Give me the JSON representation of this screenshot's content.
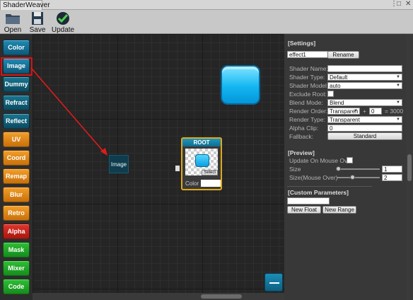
{
  "window": {
    "tab_title": "ShaderWeaver",
    "controls": [
      "⋮",
      "□",
      "✕"
    ]
  },
  "toolbar": {
    "open_label": "Open",
    "save_label": "Save",
    "update_label": "Update"
  },
  "palette": [
    {
      "label": "Color",
      "color": "blue"
    },
    {
      "label": "Image",
      "color": "blue"
    },
    {
      "label": "Dummy",
      "color": "teal"
    },
    {
      "label": "Refract",
      "color": "teal"
    },
    {
      "label": "Reflect",
      "color": "teal"
    },
    {
      "label": "UV",
      "color": "orange"
    },
    {
      "label": "Coord",
      "color": "orange"
    },
    {
      "label": "Remap",
      "color": "orange"
    },
    {
      "label": "Blur",
      "color": "orange"
    },
    {
      "label": "Retro",
      "color": "orange"
    },
    {
      "label": "Alpha",
      "color": "red"
    },
    {
      "label": "Mask",
      "color": "green"
    },
    {
      "label": "Mixer",
      "color": "green"
    },
    {
      "label": "Code",
      "color": "green"
    }
  ],
  "canvas": {
    "image_node_label": "Image",
    "root_title": "ROOT",
    "root_select_label": "Select",
    "root_color_label": "Color"
  },
  "settings": {
    "section_title": "[Settings]",
    "name_value": "effect1",
    "rename_label": "Rename",
    "shader_name_label": "Shader Name:",
    "shader_name_value": "",
    "shader_type_label": "Shader Type:",
    "shader_type_value": "Default",
    "shader_model_label": "Shader Model:",
    "shader_model_value": "auto",
    "exclude_root_label": "Exclude Root:",
    "blend_mode_label": "Blend Mode:",
    "blend_mode_value": "Blend",
    "render_order_label": "Render Order:",
    "render_order_value": "Transparen",
    "render_order_plus": "+",
    "render_order_offset": "0",
    "render_order_total": "= 3000",
    "render_type_label": "Render Type:",
    "render_type_value": "Transparent",
    "alpha_clip_label": "Alpha Clip:",
    "alpha_clip_value": "0",
    "fallback_label": "Fallback:",
    "fallback_value": "Standard"
  },
  "preview": {
    "section_title": "[Preview]",
    "update_on_mouse_over_label": "Update On Mouse Over",
    "size_label": "Size",
    "size_value": "1",
    "size_mouse_over_label": "Size(Mouse Over)",
    "size_mouse_over_value": "2"
  },
  "custom_parameters": {
    "section_title": "[Custom Parameters]",
    "input_value": "",
    "new_float_label": "New Float",
    "new_range_label": "New Range"
  }
}
